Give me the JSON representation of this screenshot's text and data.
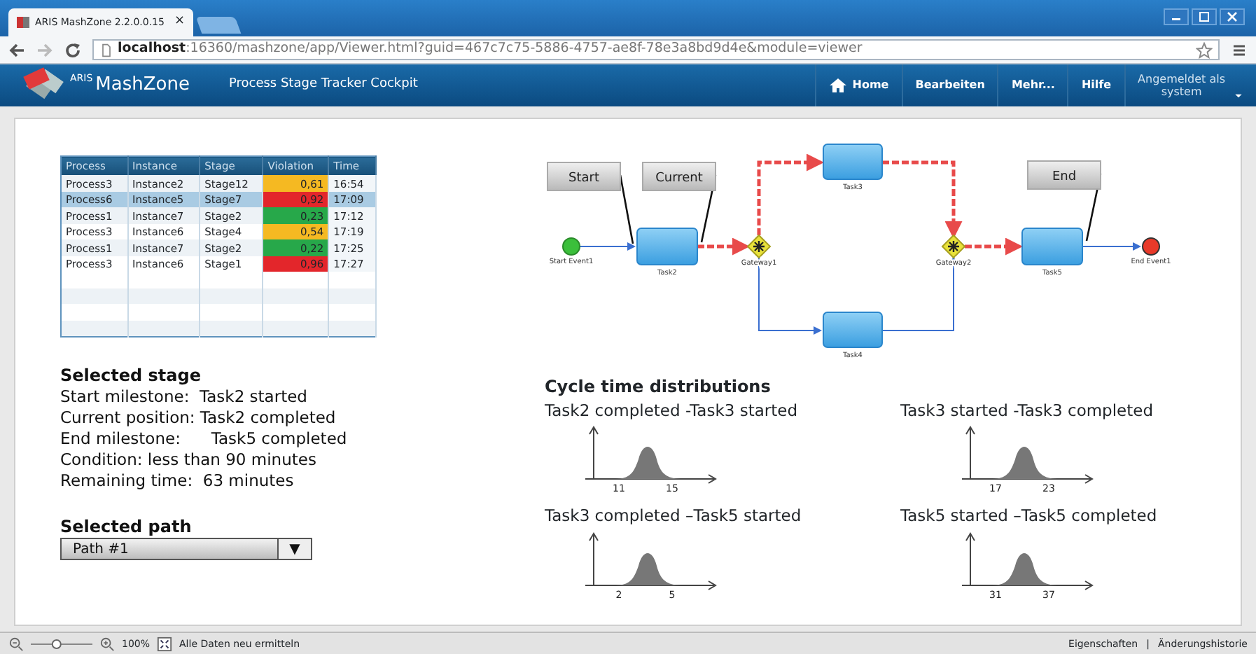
{
  "browser": {
    "tab_title": "ARIS MashZone 2.2.0.0.15",
    "tab_close": "×",
    "url_host": "localhost",
    "url_rest": ":16360/mashzone/app/Viewer.html?guid=467c7c75-5886-4757-ae8f-78e3a8bd9d4e&module=viewer"
  },
  "app": {
    "product_super": "ARIS",
    "product": "MashZone",
    "page_title": "Process Stage Tracker Cockpit",
    "nav": [
      {
        "label": "Home",
        "kind": "home"
      },
      {
        "label": "Bearbeiten",
        "kind": "plain"
      },
      {
        "label": "Mehr...",
        "kind": "plain"
      },
      {
        "label": "Hilfe",
        "kind": "plain"
      }
    ],
    "user": {
      "line1": "Angemeldet als",
      "line2": "system"
    }
  },
  "table": {
    "columns": [
      "Process",
      "Instance",
      "Stage",
      "Violation",
      "Time"
    ],
    "rows": [
      {
        "cells": [
          "Process3",
          "Instance2",
          "Stage12",
          "0,61",
          "16:54"
        ],
        "color": "#f5b922",
        "selected": false
      },
      {
        "cells": [
          "Process6",
          "Instance5",
          "Stage7",
          "0,92",
          "17:09"
        ],
        "color": "#e3262b",
        "selected": true
      },
      {
        "cells": [
          "Process1",
          "Instance7",
          "Stage2",
          "0,23",
          "17:12"
        ],
        "color": "#27a84a",
        "selected": false
      },
      {
        "cells": [
          "Process3",
          "Instance6",
          "Stage4",
          "0,54",
          "17:19"
        ],
        "color": "#f5b922",
        "selected": false
      },
      {
        "cells": [
          "Process1",
          "Instance7",
          "Stage2",
          "0,22",
          "17:25"
        ],
        "color": "#27a84a",
        "selected": false
      },
      {
        "cells": [
          "Process3",
          "Instance6",
          "Stage1",
          "0,96",
          "17:27"
        ],
        "color": "#e3262b",
        "selected": false
      }
    ]
  },
  "selected_stage": {
    "title": "Selected stage",
    "lines": [
      "Start milestone:  Task2 started",
      "Current position: Task2 completed",
      "End milestone:      Task5 completed",
      "Condition: less than 90 minutes",
      "Remaining time:  63 minutes"
    ]
  },
  "selected_path": {
    "title": "Selected path",
    "value": "Path #1",
    "toggle": "▼"
  },
  "diagram": {
    "nodes": [
      {
        "kind": "start",
        "label": "Start Event1"
      },
      {
        "kind": "task",
        "label": "Task2"
      },
      {
        "kind": "gateway",
        "label": "Gateway1"
      },
      {
        "kind": "task",
        "label": "Task3"
      },
      {
        "kind": "task",
        "label": "Task4"
      },
      {
        "kind": "gateway",
        "label": "Gateway2"
      },
      {
        "kind": "task",
        "label": "Task5"
      },
      {
        "kind": "end",
        "label": "End Event1"
      }
    ],
    "callouts": [
      "Start",
      "Current",
      "End"
    ]
  },
  "cycle": {
    "title": "Cycle time distributions",
    "charts": [
      {
        "title": "Task2 completed -Task3 started",
        "ticks": [
          "11",
          "15"
        ]
      },
      {
        "title": "Task3 started -Task3 completed",
        "ticks": [
          "17",
          "23"
        ]
      },
      {
        "title": "Task3 completed –Task5 started",
        "ticks": [
          "2",
          "5"
        ]
      },
      {
        "title": "Task5 started –Task5 completed",
        "ticks": [
          "31",
          "37"
        ]
      }
    ]
  },
  "status_bar": {
    "zoom": {
      "level": 0.4,
      "reading": "100%"
    },
    "refresh": "Alle Daten neu ermitteln",
    "links": [
      "Eigenschaften",
      "Änderungshistorie"
    ],
    "separator": "|"
  }
}
